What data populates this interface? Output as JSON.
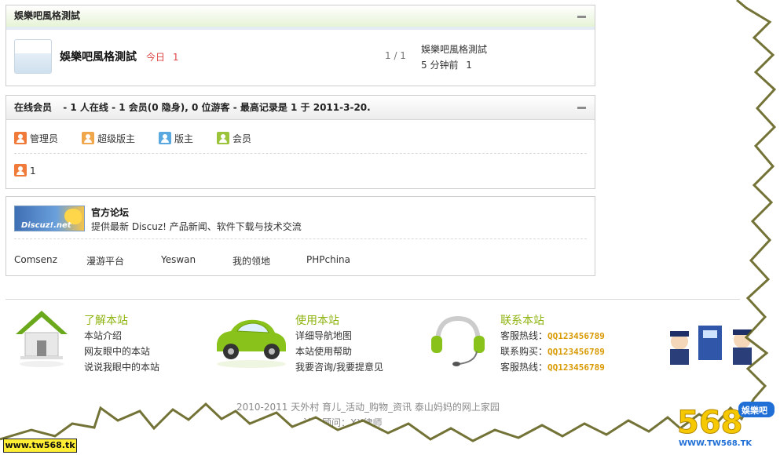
{
  "forum_section": {
    "title": "娛樂吧風格測試",
    "forum": {
      "name": "娛樂吧風格測試",
      "today_label": "今日",
      "today_count": "1",
      "count": "1 / 1",
      "last_post_title": "娛樂吧風格測試",
      "last_post_time": "5 分钟前",
      "last_post_author": "1"
    }
  },
  "online_section": {
    "title": "在线会员",
    "summary": "- 1 人在线  - 1 会员(0 隐身), 0 位游客  - 最高记录是  1 于  2011-3-20.",
    "legend": [
      {
        "label": "管理员",
        "color": "#f07a3a"
      },
      {
        "label": "超级版主",
        "color": "#f0a64a"
      },
      {
        "label": "版主",
        "color": "#5aa8e0"
      },
      {
        "label": "会员",
        "color": "#9cc43a"
      }
    ],
    "online_users": [
      {
        "name": "1",
        "color": "#f07a3a"
      }
    ]
  },
  "official_section": {
    "banner_text": "Discuz!.net",
    "title": "官方论坛",
    "description": "提供最新  Discuz! 产品新闻、软件下载与技术交流",
    "links": [
      "Comsenz",
      "漫游平台",
      "Yeswan",
      "我的领地",
      "PHPchina"
    ]
  },
  "footer": {
    "col1": {
      "title": "了解本站",
      "items": [
        "本站介绍",
        "网友眼中的本站",
        "说说我眼中的本站"
      ]
    },
    "col2": {
      "title": "使用本站",
      "items": [
        "详细导航地图",
        "本站使用帮助",
        "我要咨询/我要提意见"
      ]
    },
    "col3": {
      "title": "联系本站",
      "items": [
        {
          "label": "客服热线：",
          "qq": "QQ123456789"
        },
        {
          "label": "联系购买：",
          "qq": "QQ123456789"
        },
        {
          "label": "客服热线：",
          "qq": "QQ123456789"
        }
      ]
    },
    "copyright": "2010-2011  天外村  育儿_活动_购物_资讯  泰山妈妈的网上家园",
    "legal": "法律顾问：XX律师"
  },
  "watermarks": {
    "left": "www.tw568.tk",
    "right_number": "568",
    "right_badge": "娛樂吧",
    "right_url": "WWW.TW568.TK"
  }
}
